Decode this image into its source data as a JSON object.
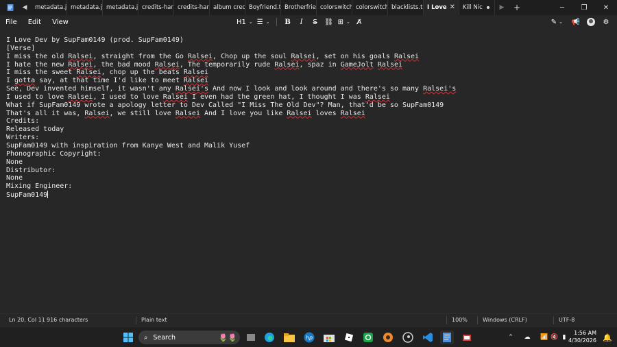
{
  "titlebar": {
    "tabs": [
      {
        "label": "metadata.jsc"
      },
      {
        "label": "metadata.jsc"
      },
      {
        "label": "metadata.jsc"
      },
      {
        "label": "credits-hard"
      },
      {
        "label": "credits-hard"
      },
      {
        "label": "album credit"
      },
      {
        "label": "Boyfriend.txt"
      },
      {
        "label": "Brotherfrien"
      },
      {
        "label": "colorswitchi"
      },
      {
        "label": "colorswitchi"
      },
      {
        "label": "blacklists.txt"
      },
      {
        "label": "I Love"
      },
      {
        "label": "Kill Nic"
      }
    ]
  },
  "menu": {
    "file": "File",
    "edit": "Edit",
    "view": "View"
  },
  "format": {
    "heading": "H1"
  },
  "editor": {
    "lines": [
      [
        {
          "t": "I Love Dev by SupFam0149 (prod. SupFam0149)"
        }
      ],
      [
        {
          "t": "[Verse]"
        }
      ],
      [
        {
          "t": "I miss the old "
        },
        {
          "t": "Ralsei",
          "s": 1
        },
        {
          "t": ", straight from the Go "
        },
        {
          "t": "Ralsei",
          "s": 1
        },
        {
          "t": ", Chop up the soul "
        },
        {
          "t": "Ralsei",
          "s": 1
        },
        {
          "t": ", set on his goals "
        },
        {
          "t": "Ralsei",
          "s": 1
        }
      ],
      [
        {
          "t": "I hate the new "
        },
        {
          "t": "Ralsei",
          "s": 1
        },
        {
          "t": ", the bad mood "
        },
        {
          "t": "Ralsei",
          "s": 1
        },
        {
          "t": ", The temporarily rude "
        },
        {
          "t": "Ralsei",
          "s": 1
        },
        {
          "t": ", spaz in "
        },
        {
          "t": "GameJolt",
          "s": 1
        },
        {
          "t": " "
        },
        {
          "t": "Ralsei",
          "s": 1
        }
      ],
      [
        {
          "t": "I miss the sweet "
        },
        {
          "t": "Ralsei",
          "s": 1
        },
        {
          "t": ", chop up the beats "
        },
        {
          "t": "Ralsei",
          "s": 1
        }
      ],
      [
        {
          "t": "I "
        },
        {
          "t": "gotta",
          "s": 1
        },
        {
          "t": " say, at that time I'd like to meet "
        },
        {
          "t": "Ralsei",
          "s": 1
        }
      ],
      [
        {
          "t": "See, Dev invented himself, it wasn't any "
        },
        {
          "t": "Ralsei's",
          "s": 1
        },
        {
          "t": " And now I look and look around and there's so many "
        },
        {
          "t": "Ralsei's",
          "s": 1
        }
      ],
      [
        {
          "t": "I used to love "
        },
        {
          "t": "Ralsei",
          "s": 1
        },
        {
          "t": ", I used to love "
        },
        {
          "t": "Ralsei",
          "s": 1
        },
        {
          "t": " I even had the green hat, I thought I was "
        },
        {
          "t": "Ralsei",
          "s": 1
        }
      ],
      [
        {
          "t": "What if SupFam0149 wrote a apology letter to Dev Called \"I Miss The Old Dev\"? Man, that'd be so SupFam0149"
        }
      ],
      [
        {
          "t": "That's all it was, "
        },
        {
          "t": "Ralsei",
          "s": 1
        },
        {
          "t": ", we still love "
        },
        {
          "t": "Ralsei",
          "s": 1
        },
        {
          "t": " And I love you like "
        },
        {
          "t": "Ralsei",
          "s": 1
        },
        {
          "t": " loves "
        },
        {
          "t": "Ralsei",
          "s": 1
        }
      ],
      [
        {
          "t": "Credits:"
        }
      ],
      [
        {
          "t": "Released today"
        }
      ],
      [
        {
          "t": "Writers:"
        }
      ],
      [
        {
          "t": "SupFam0149 with inspiration from Kanye West and Malik Yusef"
        }
      ],
      [
        {
          "t": "Phonographic Copyright:"
        }
      ],
      [
        {
          "t": "None"
        }
      ],
      [
        {
          "t": "Distributor:"
        }
      ],
      [
        {
          "t": "None"
        }
      ],
      [
        {
          "t": "Mixing Engineer:"
        }
      ],
      [
        {
          "t": "SupFam0149"
        }
      ]
    ]
  },
  "status": {
    "position": "Ln 20, Col 11",
    "chars": "916 characters",
    "format": "Plain text",
    "zoom": "100%",
    "eol": "Windows (CRLF)",
    "encoding": "UTF-8"
  },
  "taskbar": {
    "search": "Search",
    "time": "1:56 AM",
    "date": "4/30/2026"
  }
}
